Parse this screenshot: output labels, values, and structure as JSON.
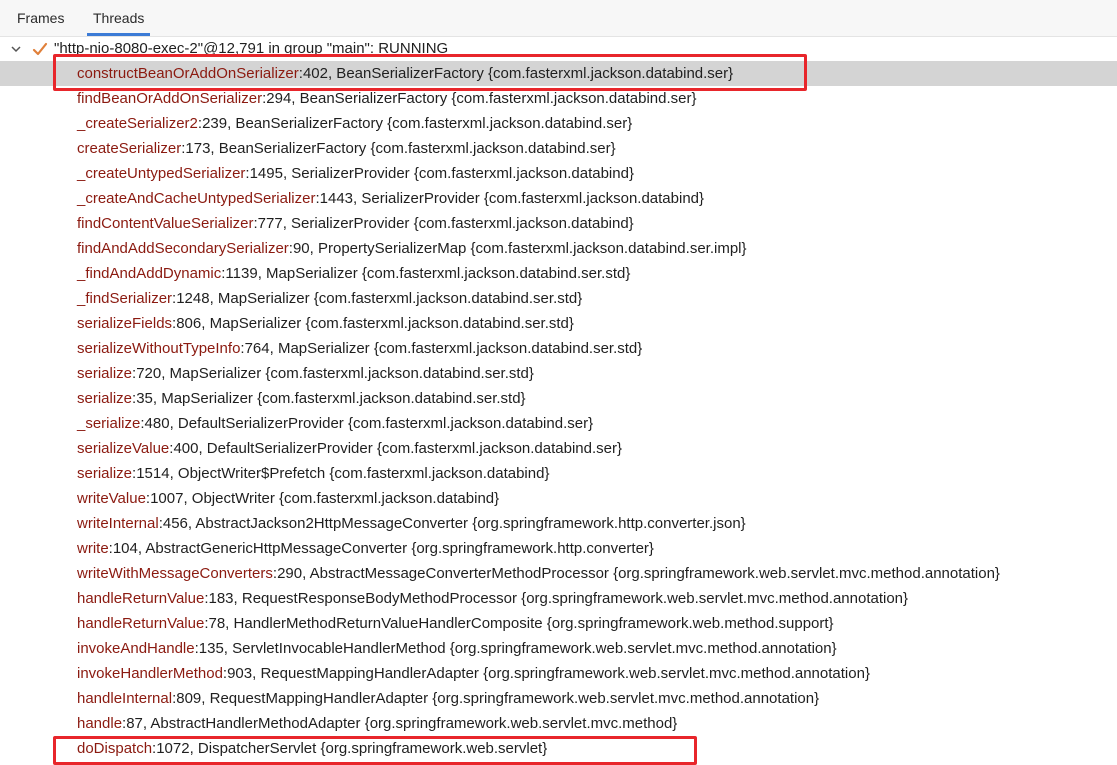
{
  "tabs": [
    {
      "label": "Frames"
    },
    {
      "label": "Threads"
    }
  ],
  "thread": {
    "label": "\"http-nio-8080-exec-2\"@12,791 in group \"main\": RUNNING"
  },
  "frames": [
    {
      "method": "constructBeanOrAddOnSerializer",
      "rest": ":402, BeanSerializerFactory {com.fasterxml.jackson.databind.ser}"
    },
    {
      "method": "findBeanOrAddOnSerializer",
      "rest": ":294, BeanSerializerFactory {com.fasterxml.jackson.databind.ser}"
    },
    {
      "method": "_createSerializer2",
      "rest": ":239, BeanSerializerFactory {com.fasterxml.jackson.databind.ser}"
    },
    {
      "method": "createSerializer",
      "rest": ":173, BeanSerializerFactory {com.fasterxml.jackson.databind.ser}"
    },
    {
      "method": "_createUntypedSerializer",
      "rest": ":1495, SerializerProvider {com.fasterxml.jackson.databind}"
    },
    {
      "method": "_createAndCacheUntypedSerializer",
      "rest": ":1443, SerializerProvider {com.fasterxml.jackson.databind}"
    },
    {
      "method": "findContentValueSerializer",
      "rest": ":777, SerializerProvider {com.fasterxml.jackson.databind}"
    },
    {
      "method": "findAndAddSecondarySerializer",
      "rest": ":90, PropertySerializerMap {com.fasterxml.jackson.databind.ser.impl}"
    },
    {
      "method": "_findAndAddDynamic",
      "rest": ":1139, MapSerializer {com.fasterxml.jackson.databind.ser.std}"
    },
    {
      "method": "_findSerializer",
      "rest": ":1248, MapSerializer {com.fasterxml.jackson.databind.ser.std}"
    },
    {
      "method": "serializeFields",
      "rest": ":806, MapSerializer {com.fasterxml.jackson.databind.ser.std}"
    },
    {
      "method": "serializeWithoutTypeInfo",
      "rest": ":764, MapSerializer {com.fasterxml.jackson.databind.ser.std}"
    },
    {
      "method": "serialize",
      "rest": ":720, MapSerializer {com.fasterxml.jackson.databind.ser.std}"
    },
    {
      "method": "serialize",
      "rest": ":35, MapSerializer {com.fasterxml.jackson.databind.ser.std}"
    },
    {
      "method": "_serialize",
      "rest": ":480, DefaultSerializerProvider {com.fasterxml.jackson.databind.ser}"
    },
    {
      "method": "serializeValue",
      "rest": ":400, DefaultSerializerProvider {com.fasterxml.jackson.databind.ser}"
    },
    {
      "method": "serialize",
      "rest": ":1514, ObjectWriter$Prefetch {com.fasterxml.jackson.databind}"
    },
    {
      "method": "writeValue",
      "rest": ":1007, ObjectWriter {com.fasterxml.jackson.databind}"
    },
    {
      "method": "writeInternal",
      "rest": ":456, AbstractJackson2HttpMessageConverter {org.springframework.http.converter.json}"
    },
    {
      "method": "write",
      "rest": ":104, AbstractGenericHttpMessageConverter {org.springframework.http.converter}"
    },
    {
      "method": "writeWithMessageConverters",
      "rest": ":290, AbstractMessageConverterMethodProcessor {org.springframework.web.servlet.mvc.method.annotation}"
    },
    {
      "method": "handleReturnValue",
      "rest": ":183, RequestResponseBodyMethodProcessor {org.springframework.web.servlet.mvc.method.annotation}"
    },
    {
      "method": "handleReturnValue",
      "rest": ":78, HandlerMethodReturnValueHandlerComposite {org.springframework.web.method.support}"
    },
    {
      "method": "invokeAndHandle",
      "rest": ":135, ServletInvocableHandlerMethod {org.springframework.web.servlet.mvc.method.annotation}"
    },
    {
      "method": "invokeHandlerMethod",
      "rest": ":903, RequestMappingHandlerAdapter {org.springframework.web.servlet.mvc.method.annotation}"
    },
    {
      "method": "handleInternal",
      "rest": ":809, RequestMappingHandlerAdapter {org.springframework.web.servlet.mvc.method.annotation}"
    },
    {
      "method": "handle",
      "rest": ":87, AbstractHandlerMethodAdapter {org.springframework.web.servlet.mvc.method}"
    },
    {
      "method": "doDispatch",
      "rest": ":1072, DispatcherServlet {org.springframework.web.servlet}"
    }
  ],
  "colors": {
    "method": "#8b1a10",
    "selected_row": "#d4d4d4",
    "highlight_box": "#e8262b",
    "check": "#e0803a",
    "tab_underline": "#3c7bd6"
  },
  "icons": {
    "expand": "chevron-down-icon",
    "status": "check-icon"
  }
}
